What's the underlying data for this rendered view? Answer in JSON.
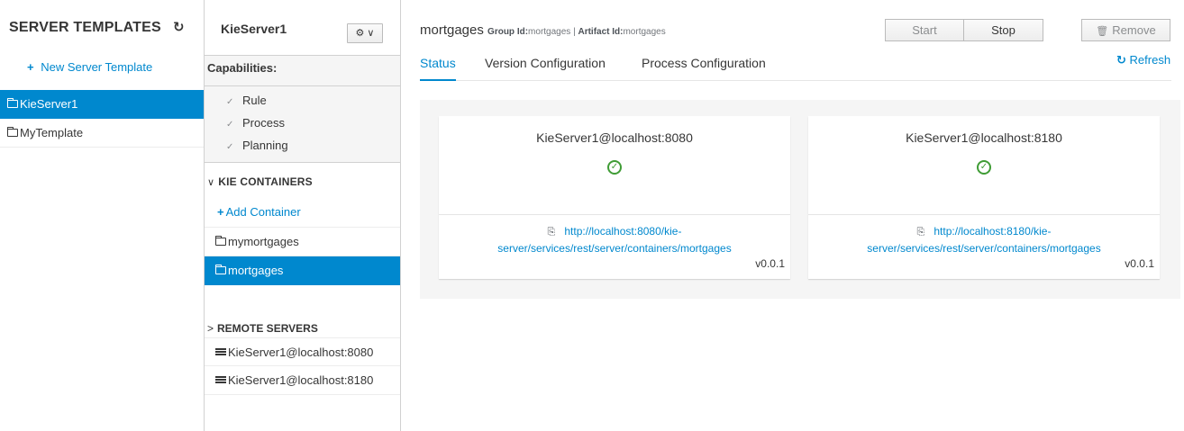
{
  "left": {
    "title": "SERVER TEMPLATES",
    "refresh_icon": "refresh-icon",
    "new_template": "New Server Template",
    "templates": [
      {
        "label": "KieServer1",
        "active": true
      },
      {
        "label": "MyTemplate",
        "active": false
      }
    ]
  },
  "middle": {
    "server_name": "KieServer1",
    "gear_label": "⚙ ∨",
    "capabilities_title": "Capabilities:",
    "capabilities": [
      "Rule",
      "Process",
      "Planning"
    ],
    "kie_containers_title": "KIE CONTAINERS",
    "add_container": "Add Container",
    "containers": [
      {
        "label": "mymortgages",
        "active": false
      },
      {
        "label": "mortgages",
        "active": true
      }
    ],
    "remote_servers_title": "REMOTE SERVERS",
    "remote_servers": [
      "KieServer1@localhost:8080",
      "KieServer1@localhost:8180"
    ]
  },
  "main": {
    "title": "mortgages",
    "group_label": "Group Id:",
    "group_value": "mortgages",
    "separator": "|",
    "artifact_label": "Artifact Id:",
    "artifact_value": "mortgages",
    "buttons": {
      "start": "Start",
      "stop": "Stop",
      "remove": "Remove"
    },
    "tabs": [
      "Status",
      "Version Configuration",
      "Process Configuration"
    ],
    "refresh": "Refresh",
    "cards": [
      {
        "name": "KieServer1@localhost:8080",
        "url_line1": "http://localhost:8080/kie-",
        "url_line2": "server/services/rest/server/containers/mortgages",
        "version": "v0.0.1"
      },
      {
        "name": "KieServer1@localhost:8180",
        "url_line1": "http://localhost:8180/kie-",
        "url_line2": "server/services/rest/server/containers/mortgages",
        "version": "v0.0.1"
      }
    ]
  },
  "colors": {
    "accent": "#0088ce",
    "success": "#3f9c35",
    "panel_bg": "#f5f5f5"
  }
}
